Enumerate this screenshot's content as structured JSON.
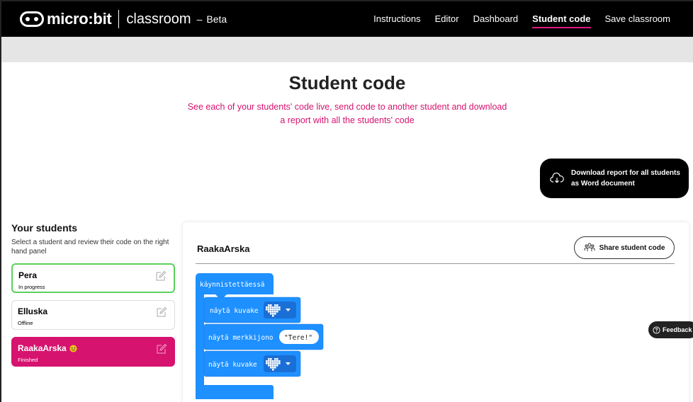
{
  "nav": {
    "brand": "micro:bit",
    "product": "classroom",
    "dash": "–",
    "beta": "Beta",
    "items": [
      "Instructions",
      "Editor",
      "Dashboard",
      "Student code",
      "Save classroom"
    ]
  },
  "header": {
    "title": "Student code",
    "subtitle": "See each of your students' code live, send code to another student and download a report with all the students' code",
    "download_line1": "Download report for all students",
    "download_line2": "as Word document"
  },
  "students": {
    "title": "Your students",
    "description": "Select a student and review their code on the right hand panel",
    "list": [
      {
        "name": "Pera",
        "status": "In progress"
      },
      {
        "name": "Elluska",
        "status": "Offline"
      },
      {
        "name": "RaakaArska",
        "status": "Finished"
      }
    ]
  },
  "panel": {
    "student_name": "RaakaArska",
    "share_label": "Share student code",
    "blocks": {
      "on_start": "käynnistettäessä",
      "show_icon_1": "näytä kuvake",
      "show_string": "näytä merkkijono",
      "string_value": "\"Tere!\"",
      "show_icon_2": "näytä kuvake"
    }
  },
  "feedback_label": "Feedback",
  "colors": {
    "accent": "#d6136f",
    "block": "#1e90ff",
    "in_progress_border": "#5bd15b"
  }
}
